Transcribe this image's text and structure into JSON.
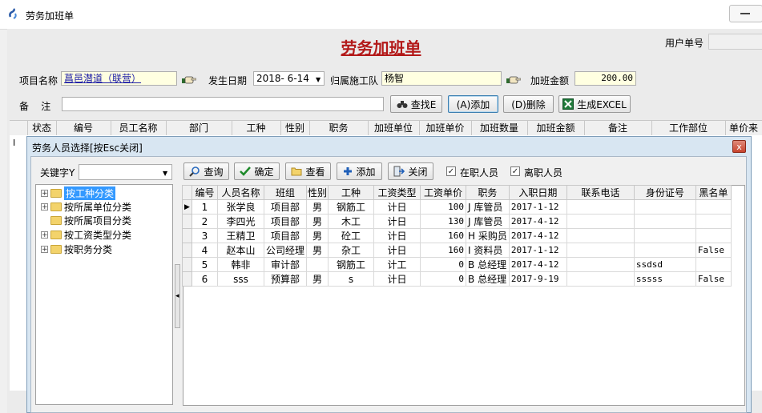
{
  "window": {
    "title": "劳务加班单"
  },
  "form": {
    "heading": "劳务加班单",
    "user_label": "用户单号",
    "user_value": "",
    "project_label": "项目名称",
    "project_value": "菖邑潜道（联营）",
    "date_label": "发生日期",
    "date_value": "2018- 6-14",
    "team_label": "归属施工队",
    "team_value": "杨智",
    "amount_label": "加班金额",
    "amount_value": "200.00",
    "note_label": "备    注",
    "note_value": ""
  },
  "toolbar": {
    "find": "查找E",
    "add": "(A)添加",
    "delete": "(D)删除",
    "excel": "生成EXCEL"
  },
  "main_grid": {
    "columns": [
      "状态",
      "编号",
      "员工名称",
      "部门",
      "工种",
      "性别",
      "职务",
      "加班单位",
      "加班单价",
      "加班数量",
      "加班金额",
      "备注",
      "工作部位",
      "单价来"
    ],
    "row_marker": "I"
  },
  "dialog": {
    "title": "劳务人员选择[按Esc关闭]",
    "close": "x",
    "keyword_label": "关键字Y",
    "keyword_value": "",
    "buttons": {
      "query": "查询",
      "ok": "确定",
      "view": "查看",
      "add": "添加",
      "close": "关闭"
    },
    "checkboxes": {
      "active": "在职人员",
      "left": "离职人员",
      "active_checked": true,
      "left_checked": true
    },
    "tree": [
      {
        "label": "按工种分类",
        "expandable": true,
        "selected": true
      },
      {
        "label": "按所属单位分类",
        "expandable": true,
        "selected": false
      },
      {
        "label": "按所属项目分类",
        "expandable": false,
        "selected": false
      },
      {
        "label": "按工资类型分类",
        "expandable": true,
        "selected": false
      },
      {
        "label": "按职务分类",
        "expandable": true,
        "selected": false
      }
    ],
    "columns": [
      "编号",
      "人员名称",
      "班组",
      "性别",
      "工种",
      "工资类型",
      "工资单价",
      "职务",
      "入职日期",
      "联系电话",
      "身份证号",
      "黑名单"
    ],
    "rows": [
      {
        "no": "1",
        "name": "张学良",
        "group": "项目部",
        "sex": "男",
        "trade": "钢筋工",
        "wage_type": "计日",
        "price": "100",
        "title": "J 库管员",
        "date": "2017-1-12",
        "phone": "",
        "id": "",
        "black": ""
      },
      {
        "no": "2",
        "name": "李四光",
        "group": "项目部",
        "sex": "男",
        "trade": "木工",
        "wage_type": "计日",
        "price": "130",
        "title": "J 库管员",
        "date": "2017-4-12",
        "phone": "",
        "id": "",
        "black": ""
      },
      {
        "no": "3",
        "name": "王精卫",
        "group": "项目部",
        "sex": "男",
        "trade": "砼工",
        "wage_type": "计日",
        "price": "160",
        "title": "H 采购员",
        "date": "2017-4-12",
        "phone": "",
        "id": "",
        "black": ""
      },
      {
        "no": "4",
        "name": "赵本山",
        "group": "公司经理",
        "sex": "男",
        "trade": "杂工",
        "wage_type": "计日",
        "price": "160",
        "title": "I 资料员",
        "date": "2017-1-12",
        "phone": "",
        "id": "",
        "black": "False"
      },
      {
        "no": "5",
        "name": "韩非",
        "group": "审计部",
        "sex": "",
        "trade": "钢筋工",
        "wage_type": "计工",
        "price": "0",
        "title": "B 总经理",
        "date": "2017-4-12",
        "phone": "",
        "id": "ssdsd",
        "black": ""
      },
      {
        "no": "6",
        "name": "sss",
        "group": "预算部",
        "sex": "男",
        "trade": "s",
        "wage_type": "计日",
        "price": "0",
        "title": "B 总经理",
        "date": "2017-9-19",
        "phone": "",
        "id": "sssss",
        "black": "False"
      }
    ],
    "current_row_marker": "▶"
  },
  "colors": {
    "heading": "#b31919",
    "selection": "#3399ff",
    "dialog_frame": "#d8e6f2"
  }
}
